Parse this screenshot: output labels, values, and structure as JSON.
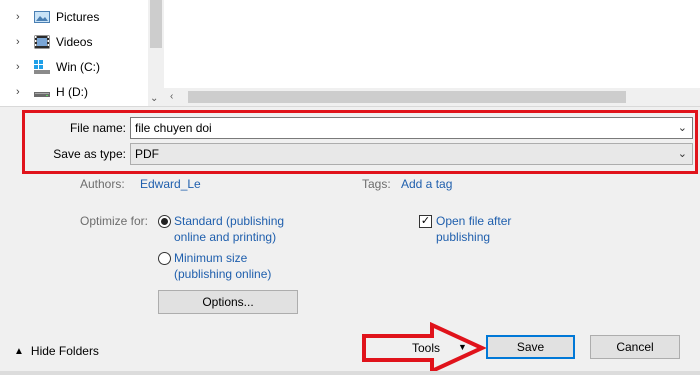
{
  "tree": {
    "items": [
      {
        "label": "Pictures",
        "icon": "pictures-icon"
      },
      {
        "label": "Videos",
        "icon": "videos-icon"
      },
      {
        "label": "Win (C:)",
        "icon": "windows-drive-icon"
      },
      {
        "label": "H (D:)",
        "icon": "drive-icon"
      }
    ]
  },
  "form": {
    "file_name_label": "File name:",
    "file_name_value": "file chuyen doi",
    "save_type_label": "Save as type:",
    "save_type_value": "PDF"
  },
  "meta": {
    "authors_label": "Authors:",
    "authors_value": "Edward_Le",
    "tags_label": "Tags:",
    "tags_value": "Add a tag"
  },
  "optimize": {
    "label": "Optimize for:",
    "standard_line1": "Standard (publishing",
    "standard_line2": "online and printing)",
    "minimum_line1": "Minimum size",
    "minimum_line2": "(publishing online)",
    "selected": "standard"
  },
  "open_after": {
    "line1": "Open file after",
    "line2": "publishing",
    "checked": true
  },
  "buttons": {
    "options": "Options...",
    "tools": "Tools",
    "save": "Save",
    "cancel": "Cancel",
    "hide_folders": "Hide Folders"
  },
  "colors": {
    "highlight": "#e0131b",
    "link": "#1f5fad",
    "focus": "#0078d7"
  }
}
